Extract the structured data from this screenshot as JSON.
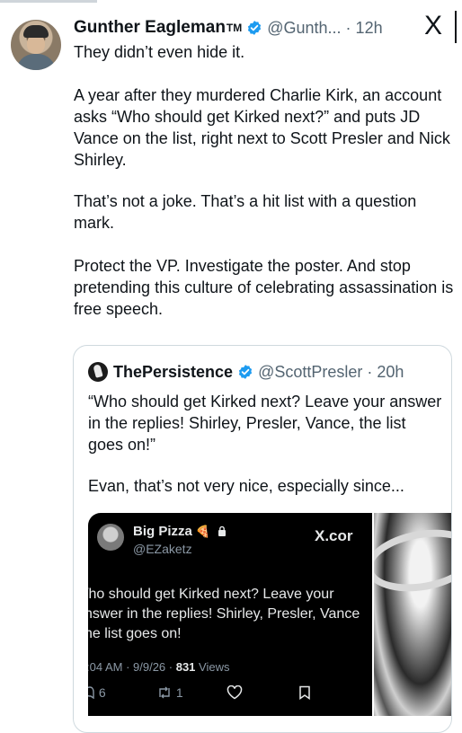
{
  "tweet": {
    "display_name": "Gunther Eagleman",
    "tm": "TM",
    "handle_time": "@Gunth... · 12h",
    "platform_mark": "X",
    "paragraphs": [
      "They didn’t even hide it.",
      "A year after they murdered Charlie Kirk, an account asks “Who should get Kirked next?” and puts JD Vance on the list, right next to Scott Presler and Nick Shirley.",
      "That’s not a joke. That’s a hit list with a question mark.",
      "Protect the VP. Investigate the poster. And stop pretending this culture of celebrating assassination is free speech."
    ]
  },
  "quoted": {
    "display_name": "ThePersistence",
    "handle_time": "@ScottPresler · 20h",
    "paragraphs": [
      "“Who should get Kirked next? Leave your answer in the replies! Shirley, Presler, Vance, the list goes on!”",
      "Evan, that’s not very nice, especially since..."
    ],
    "media": {
      "display_name": "Big Pizza",
      "handle": "@EZaketz",
      "x_link": "X.cor",
      "lines": [
        "/ho should get Kirked next? Leave your",
        "nswer in the replies! Shirley, Presler, Vance",
        "ne list goes on!"
      ],
      "meta_time": ":04 AM · 9/9/26 · ",
      "views_count": "831",
      "views_label": " Views",
      "reply_count": "6",
      "repost_count": "1"
    }
  },
  "colors": {
    "text": "#0f1419",
    "secondary": "#536471",
    "verified": "#1d9bf0",
    "border": "#cfd9de"
  },
  "icons": [
    "verified-badge-icon",
    "x-logo-icon",
    "pizza-icon",
    "lock-icon",
    "reply-icon",
    "repost-icon",
    "like-icon",
    "bookmark-icon"
  ]
}
